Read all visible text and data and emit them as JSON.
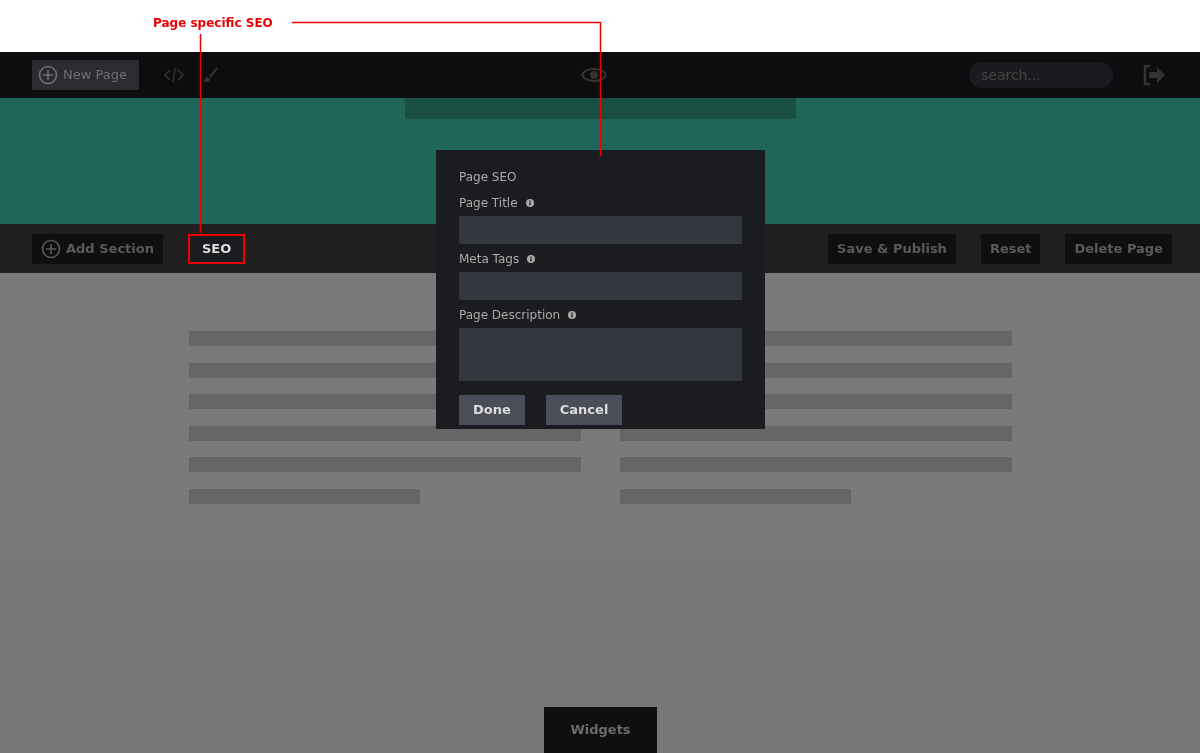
{
  "annotation": {
    "label": "Page specific SEO"
  },
  "toolbar": {
    "new_page": "New Page",
    "search": {
      "placeholder": "search..."
    }
  },
  "action_bar": {
    "left": [
      {
        "label": "Add Section",
        "kind": "icon",
        "highlighted": false
      },
      {
        "label": "SEO",
        "kind": "plain",
        "highlighted": true
      }
    ],
    "right": [
      "Save & Publish",
      "Reset",
      "Delete Page"
    ]
  },
  "modal": {
    "title": "Page SEO",
    "fields": [
      {
        "label": "Page Title",
        "kind": "input"
      },
      {
        "label": "Meta Tags",
        "kind": "input"
      },
      {
        "label": "Page Description",
        "kind": "textarea"
      }
    ],
    "buttons": [
      "Done",
      "Cancel"
    ]
  },
  "widgets_tab": "Widgets"
}
